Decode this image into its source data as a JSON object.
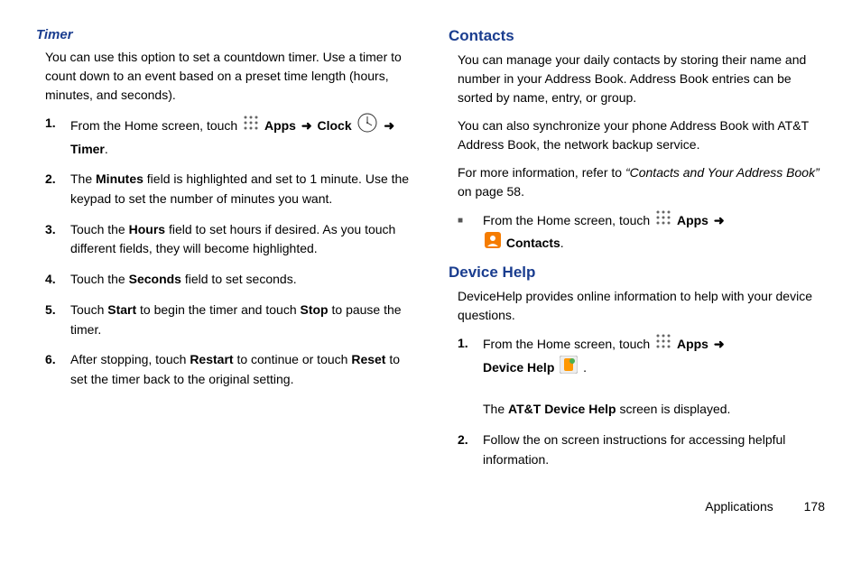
{
  "left": {
    "timer_heading": "Timer",
    "timer_intro": "You can use this option to set a countdown timer. Use a timer to count down to an event based on a preset time length (hours, minutes, and seconds).",
    "steps": {
      "s1_a": "From the Home screen, touch ",
      "s1_apps": "Apps",
      "s1_clock": "Clock",
      "s1_timer": "Timer",
      "s1_period": ".",
      "s2_a": "The ",
      "s2_min": "Minutes",
      "s2_b": " field is highlighted and set to 1 minute. Use the keypad to set the number of minutes you want.",
      "s3_a": "Touch the ",
      "s3_hours": "Hours",
      "s3_b": " field to set hours if desired. As you touch different fields, they will become highlighted.",
      "s4_a": "Touch the ",
      "s4_sec": "Seconds",
      "s4_b": " field to set seconds.",
      "s5_a": "Touch ",
      "s5_start": "Start",
      "s5_b": " to begin the timer and touch ",
      "s5_stop": "Stop",
      "s5_c": " to pause the timer.",
      "s6_a": "After stopping, touch ",
      "s6_restart": "Restart",
      "s6_b": " to continue or touch ",
      "s6_reset": "Reset",
      "s6_c": " to set the timer back to the original setting."
    }
  },
  "right": {
    "contacts_heading": "Contacts",
    "contacts_p1": "You can manage your daily contacts by storing their name and number in your Address Book. Address Book entries can be sorted by name, entry, or group.",
    "contacts_p2": "You can also synchronize your phone Address Book with AT&T Address Book, the network backup service.",
    "contacts_p3_a": "For more information, refer to ",
    "contacts_p3_it": "“Contacts and Your Address Book”",
    "contacts_p3_b": " on page 58.",
    "contacts_bullet_a": "From the Home screen, touch ",
    "contacts_apps": "Apps",
    "contacts_name": "Contacts",
    "contacts_period": ".",
    "dh_heading": "Device Help",
    "dh_intro": "DeviceHelp provides online information to help with your device questions.",
    "dh_s1_a": "From the Home screen, touch ",
    "dh_s1_apps": "Apps",
    "dh_s1_dh": "Device Help",
    "dh_s1_period": " .",
    "dh_s1_line2_a": "The ",
    "dh_s1_line2_b": "AT&T Device Help",
    "dh_s1_line2_c": " screen is displayed.",
    "dh_s2": "Follow the on screen instructions for accessing helpful information."
  },
  "footer": {
    "section": "Applications",
    "page": "178"
  },
  "nums": {
    "n1": "1.",
    "n2": "2.",
    "n3": "3.",
    "n4": "4.",
    "n5": "5.",
    "n6": "6."
  },
  "glyphs": {
    "arrow": "➜",
    "square": "■"
  }
}
